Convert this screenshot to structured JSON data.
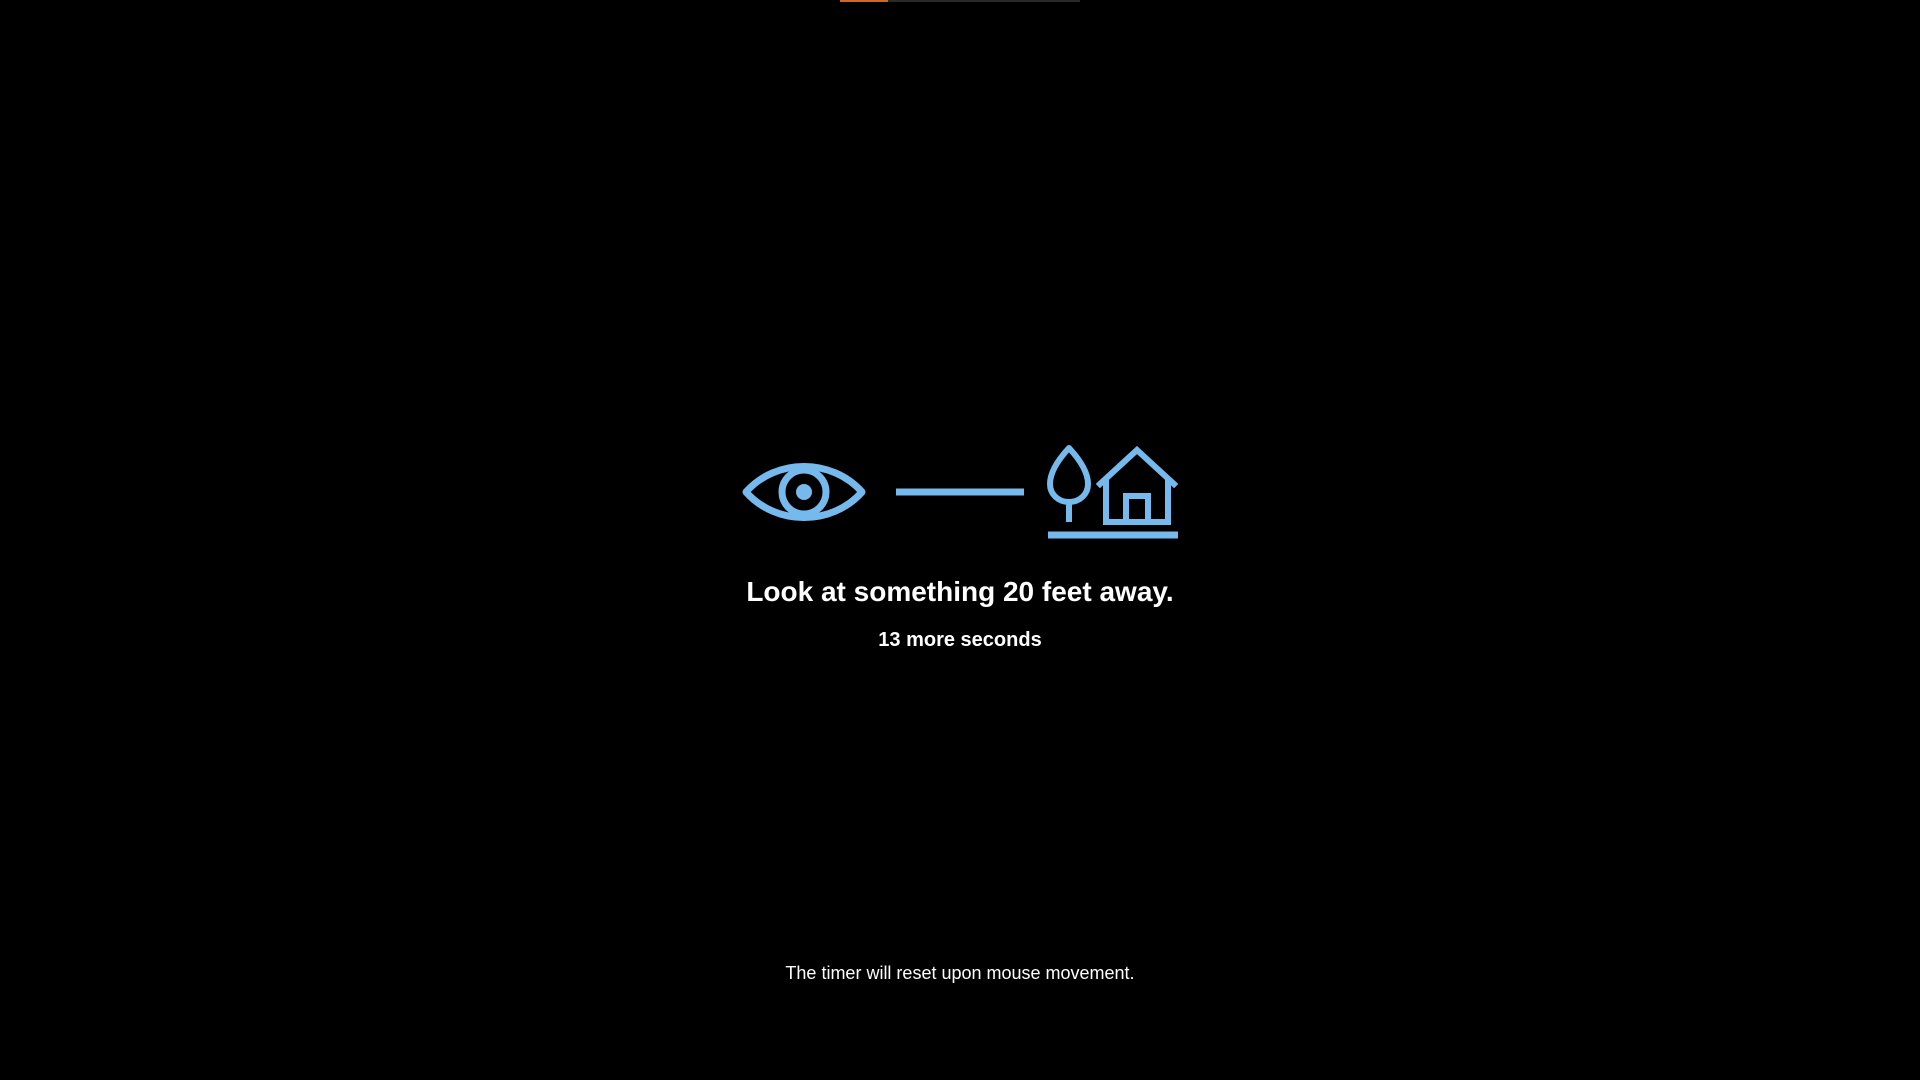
{
  "window": {
    "background": "#000000",
    "accent": "#76b9ed",
    "text_color": "#ffffff"
  },
  "progress": {
    "fraction_complete": 0.2,
    "fill_color": "#c96a2b",
    "track_color": "#2a2a2a"
  },
  "illustration": {
    "icons": [
      "eye-icon",
      "distance-line-icon",
      "tree-icon",
      "house-icon"
    ]
  },
  "message": {
    "headline": "Look at something 20 feet away.",
    "countdown": "13 more seconds",
    "footer": "The timer will reset upon mouse movement."
  }
}
